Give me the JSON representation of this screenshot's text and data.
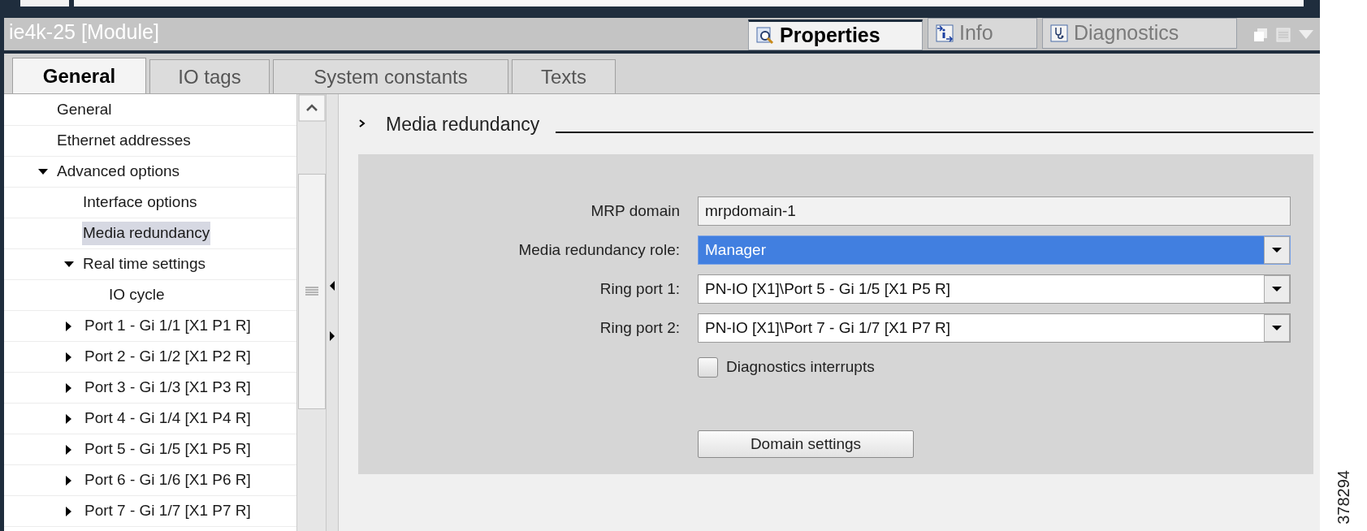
{
  "window": {
    "title": "ie4k-25 [Module]"
  },
  "inspector_tabs": [
    {
      "kind": "properties",
      "label": "Properties",
      "selected": true
    },
    {
      "kind": "info",
      "label": "Info",
      "selected": false
    },
    {
      "kind": "diagnostics",
      "label": "Diagnostics",
      "selected": false
    }
  ],
  "tabs": [
    {
      "label": "General",
      "selected": true
    },
    {
      "label": "IO tags",
      "selected": false
    },
    {
      "label": "System constants",
      "selected": false
    },
    {
      "label": "Texts",
      "selected": false
    }
  ],
  "tree": {
    "items": [
      {
        "label": "General",
        "selected": false
      },
      {
        "label": "Ethernet addresses",
        "selected": false
      },
      {
        "label": "Advanced options",
        "selected": false,
        "expanded": true,
        "children": [
          {
            "label": "Interface options",
            "selected": false
          },
          {
            "label": "Media redundancy",
            "selected": true
          },
          {
            "label": "Real time settings",
            "selected": false,
            "expanded": true,
            "children": [
              {
                "label": "IO cycle",
                "selected": false
              }
            ]
          },
          {
            "label": "Port 1 - Gi 1/1 [X1 P1 R]",
            "selected": false,
            "expanded": false
          },
          {
            "label": "Port 2 - Gi 1/2 [X1 P2 R]",
            "selected": false,
            "expanded": false
          },
          {
            "label": "Port 3 - Gi 1/3 [X1 P3 R]",
            "selected": false,
            "expanded": false
          },
          {
            "label": "Port 4 - Gi 1/4 [X1 P4 R]",
            "selected": false,
            "expanded": false
          },
          {
            "label": "Port 5 - Gi 1/5 [X1 P5 R]",
            "selected": false,
            "expanded": false
          },
          {
            "label": "Port 6 - Gi 1/6 [X1 P6 R]",
            "selected": false,
            "expanded": false
          },
          {
            "label": "Port 7 - Gi 1/7 [X1 P7 R]",
            "selected": false,
            "expanded": false
          }
        ]
      }
    ]
  },
  "section": {
    "title": "Media redundancy"
  },
  "fields": [
    {
      "kind": "text",
      "label": "MRP domain",
      "value": "mrpdomain-1",
      "focused": false
    },
    {
      "kind": "dropdown",
      "label": "Media redundancy role:",
      "value": "Manager",
      "focused": true
    },
    {
      "kind": "dropdown",
      "label": "Ring port 1:",
      "value": "PN-IO [X1]\\Port 5 - Gi 1/5 [X1 P5 R]",
      "focused": false
    },
    {
      "kind": "dropdown",
      "label": "Ring port 2:",
      "value": "PN-IO [X1]\\Port 7 - Gi 1/7 [X1 P7 R]",
      "focused": false
    }
  ],
  "checkbox": {
    "label": "Diagnostics interrupts",
    "checked": false
  },
  "button": {
    "label": "Domain settings"
  },
  "figure_number": "378294"
}
